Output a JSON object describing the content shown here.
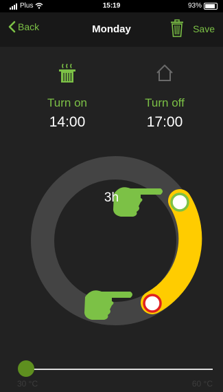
{
  "status_bar": {
    "carrier": "Plus",
    "time": "15:19",
    "battery": "93%"
  },
  "nav": {
    "back_label": "Back",
    "title": "Monday",
    "save_label": "Save",
    "trash_icon": "trash-icon"
  },
  "schedule": {
    "turn_on": {
      "label": "Turn on",
      "time": "14:00",
      "icon": "heating-pot-icon"
    },
    "turn_off": {
      "label": "Turn off",
      "time": "17:00",
      "icon": "house-icon"
    },
    "duration": "3h"
  },
  "temperature_slider": {
    "min_label": "30 °C",
    "max_label": "60 °C",
    "value_fraction": 0.0
  },
  "colors": {
    "accent": "#7cc146",
    "arc": "#ffcc00",
    "ring": "#444444",
    "background": "#222222",
    "nav_background": "#181818",
    "start_handle": "#7cc146",
    "end_handle": "#e02020"
  }
}
